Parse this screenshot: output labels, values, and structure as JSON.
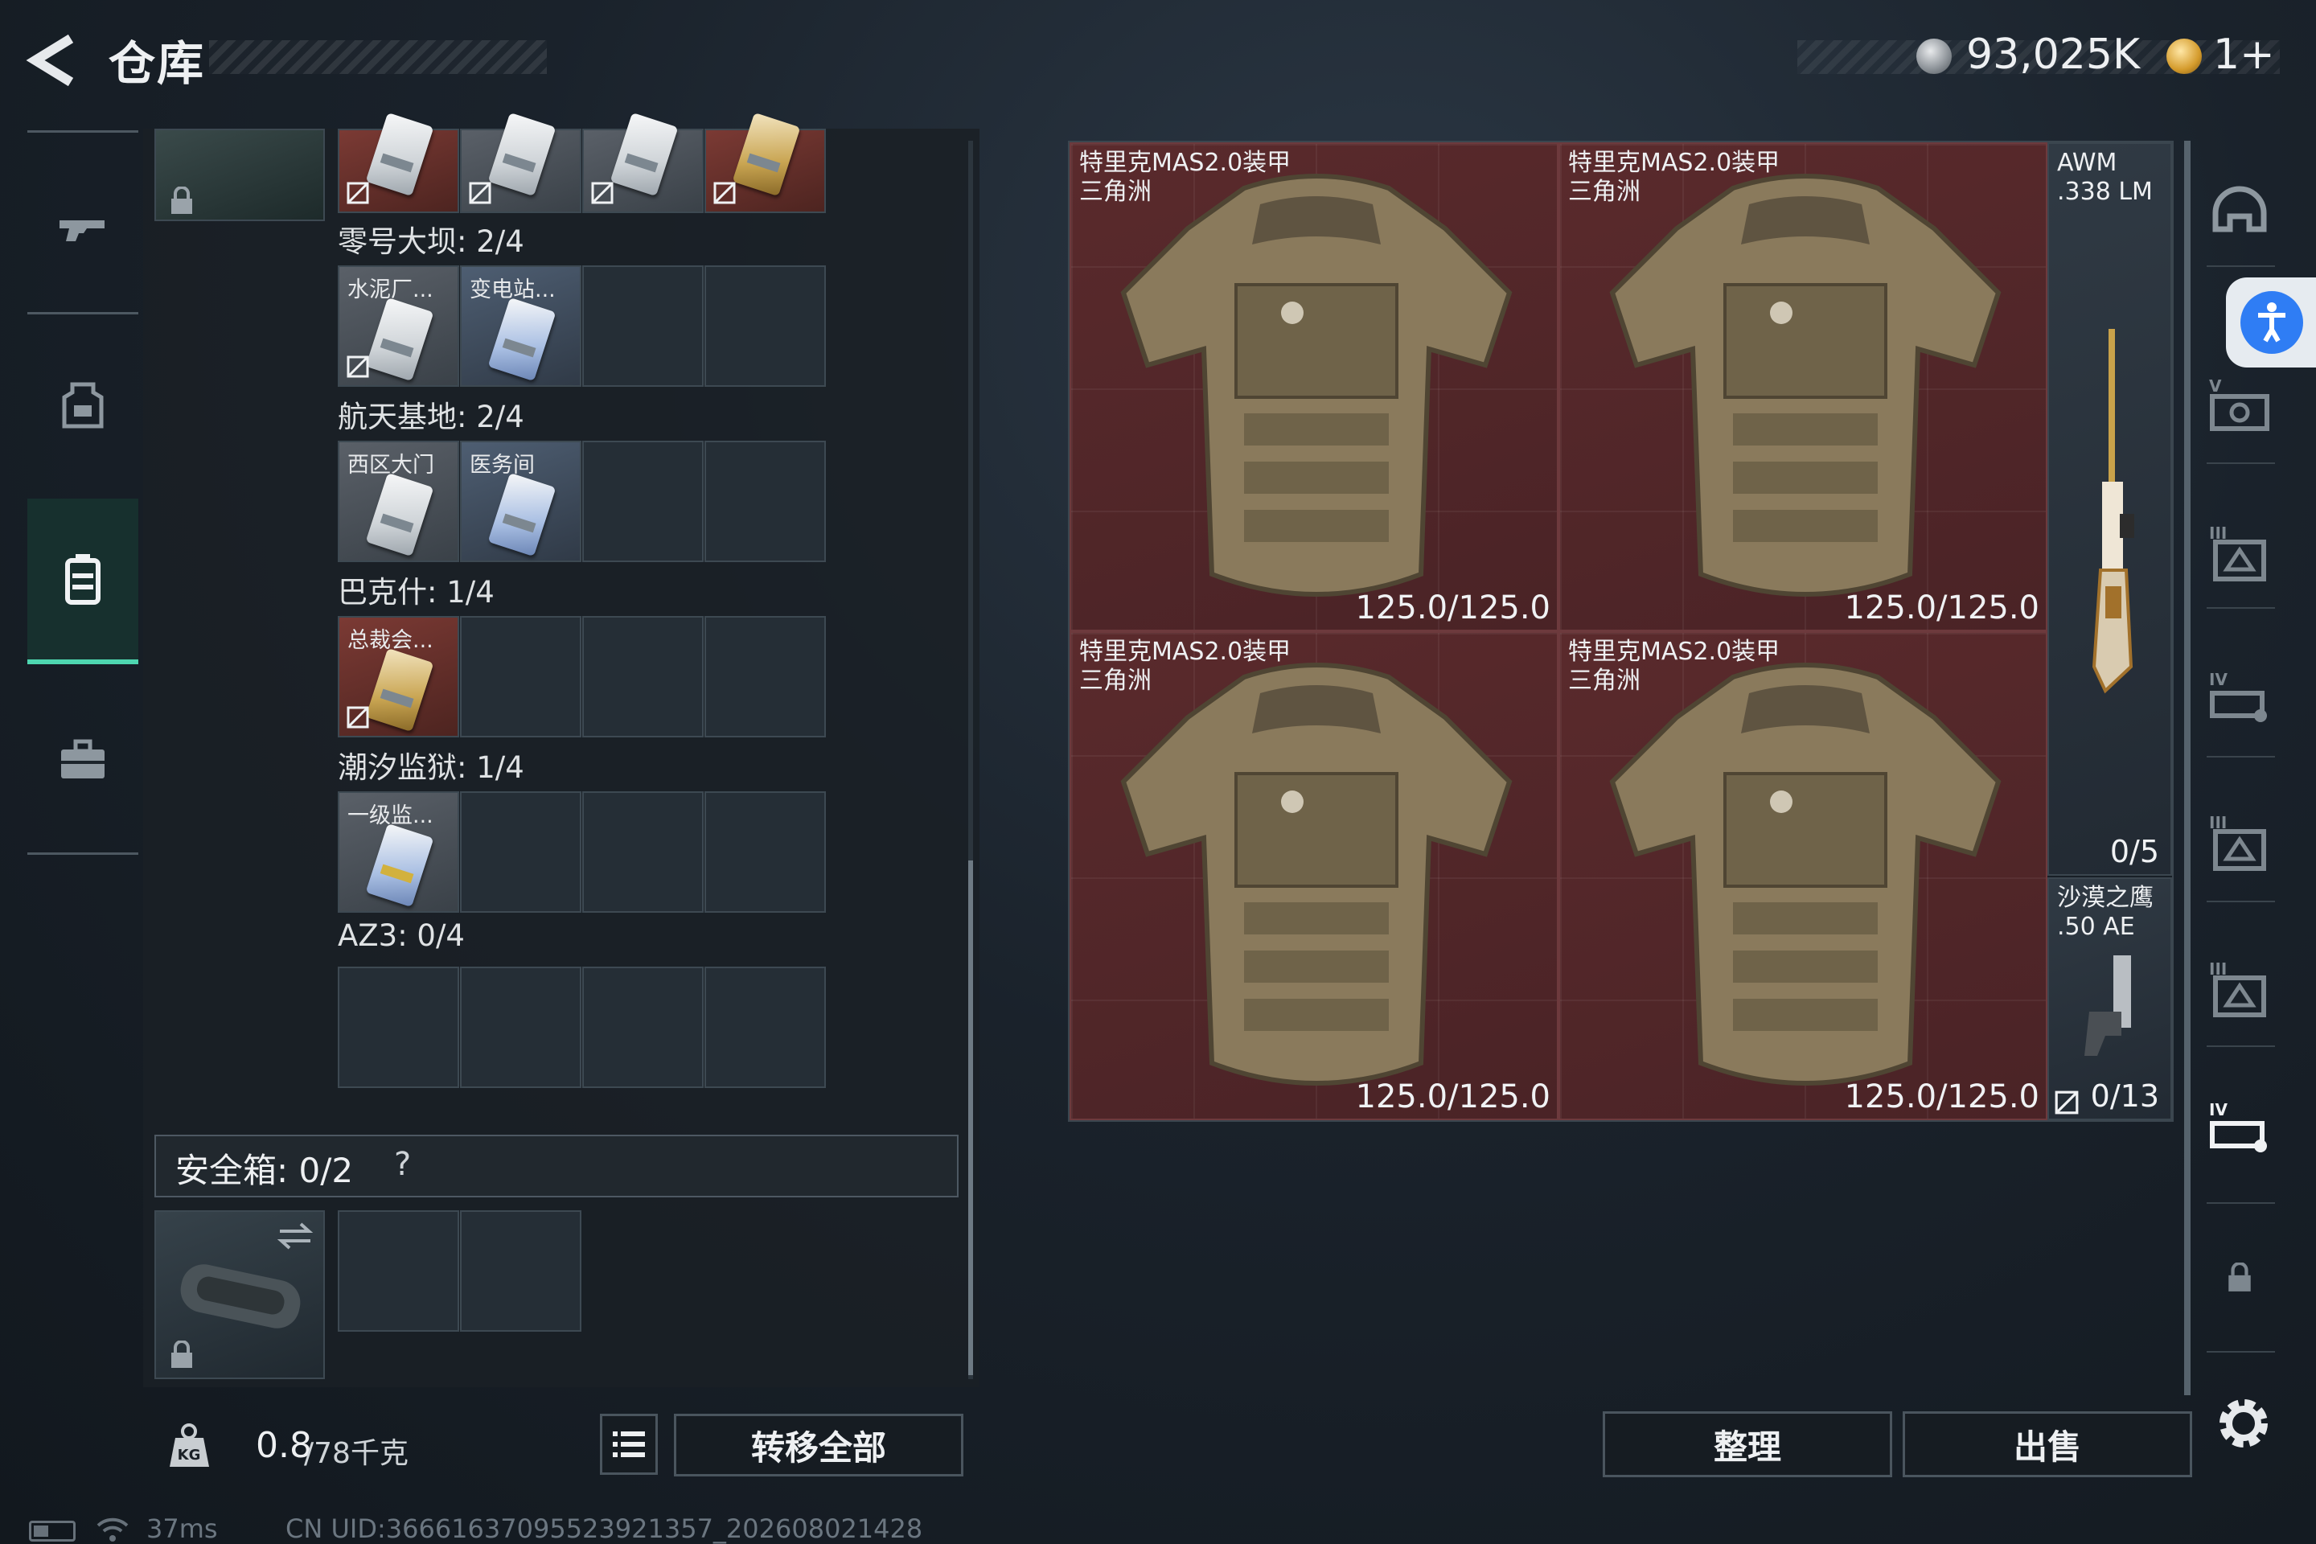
{
  "header": {
    "title": "仓库",
    "currency": "93,025K",
    "tickets": "1+"
  },
  "left_panel": {
    "sections": [
      {
        "title": "零号大坝: 2/4",
        "cards": []
      },
      {
        "title": "航天基地: 2/4",
        "cards": [
          "水泥厂...",
          "变电站..."
        ]
      },
      {
        "title": "巴克什: 1/4",
        "cards": [
          "西区大门",
          "医务间"
        ]
      },
      {
        "title": "潮汐监狱: 1/4",
        "cards": [
          "总裁会..."
        ]
      },
      {
        "title": "AZ3: 0/4",
        "cards": [
          "一级监..."
        ]
      }
    ],
    "safe_box": {
      "label": "安全箱: 0/2",
      "help": "?"
    },
    "weight": {
      "value": "0.8",
      "capacity": "/78千克"
    },
    "transfer_all_label": "转移全部"
  },
  "stash": {
    "armors": [
      {
        "name": "特里克MAS2.0装甲\n三角洲",
        "durability": "125.0/125.0"
      },
      {
        "name": "特里克MAS2.0装甲\n三角洲",
        "durability": "125.0/125.0"
      },
      {
        "name": "特里克MAS2.0装甲\n三角洲",
        "durability": "125.0/125.0"
      },
      {
        "name": "特里克MAS2.0装甲\n三角洲",
        "durability": "125.0/125.0"
      }
    ],
    "weapons": [
      {
        "name": "AWM\n.338 LM",
        "ammo": "0/5"
      },
      {
        "name": "沙漠之鹰\n.50 AE",
        "ammo": "0/13"
      }
    ]
  },
  "actions": {
    "tidy_label": "整理",
    "sell_label": "出售"
  },
  "status": {
    "ping": "37ms",
    "uid": "CN UID:366616370955239213​57_202608021428"
  },
  "colors": {
    "accent": "#4ed6b0",
    "armor_bg": "#4a2326",
    "accessibility_blue": "#2f7df4"
  },
  "icons": [
    "back-arrow-icon",
    "silver-coin-icon",
    "gold-coin-icon",
    "gun-icon",
    "vest-icon",
    "backpack-icon",
    "briefcase-icon",
    "lock-icon",
    "no-drop-icon",
    "swap-icon",
    "kg-icon",
    "list-icon",
    "helmet-icon",
    "accessibility-icon",
    "armor-plate-icon",
    "settings-icon",
    "battery-icon",
    "wifi-icon"
  ]
}
